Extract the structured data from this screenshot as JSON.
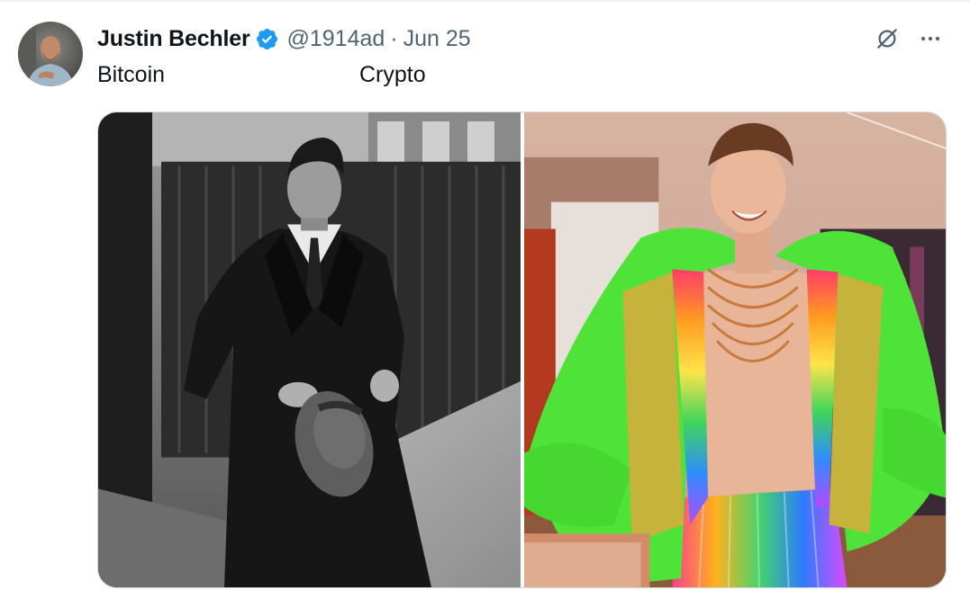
{
  "author": {
    "name": "Justin Bechler",
    "handle": "@1914ad",
    "separator": "·",
    "date": "Jun 25",
    "avatar_icon": "profile-photo"
  },
  "tweet": {
    "text_left": "Bitcoin",
    "text_right": "Crypto"
  },
  "icons": {
    "verified": "verified-badge-icon",
    "grok": "grok-icon",
    "more": "more-icon"
  },
  "colors": {
    "verified_blue": "#1d9bf0",
    "secondary_text": "#536471",
    "primary_text": "#0f1419"
  }
}
